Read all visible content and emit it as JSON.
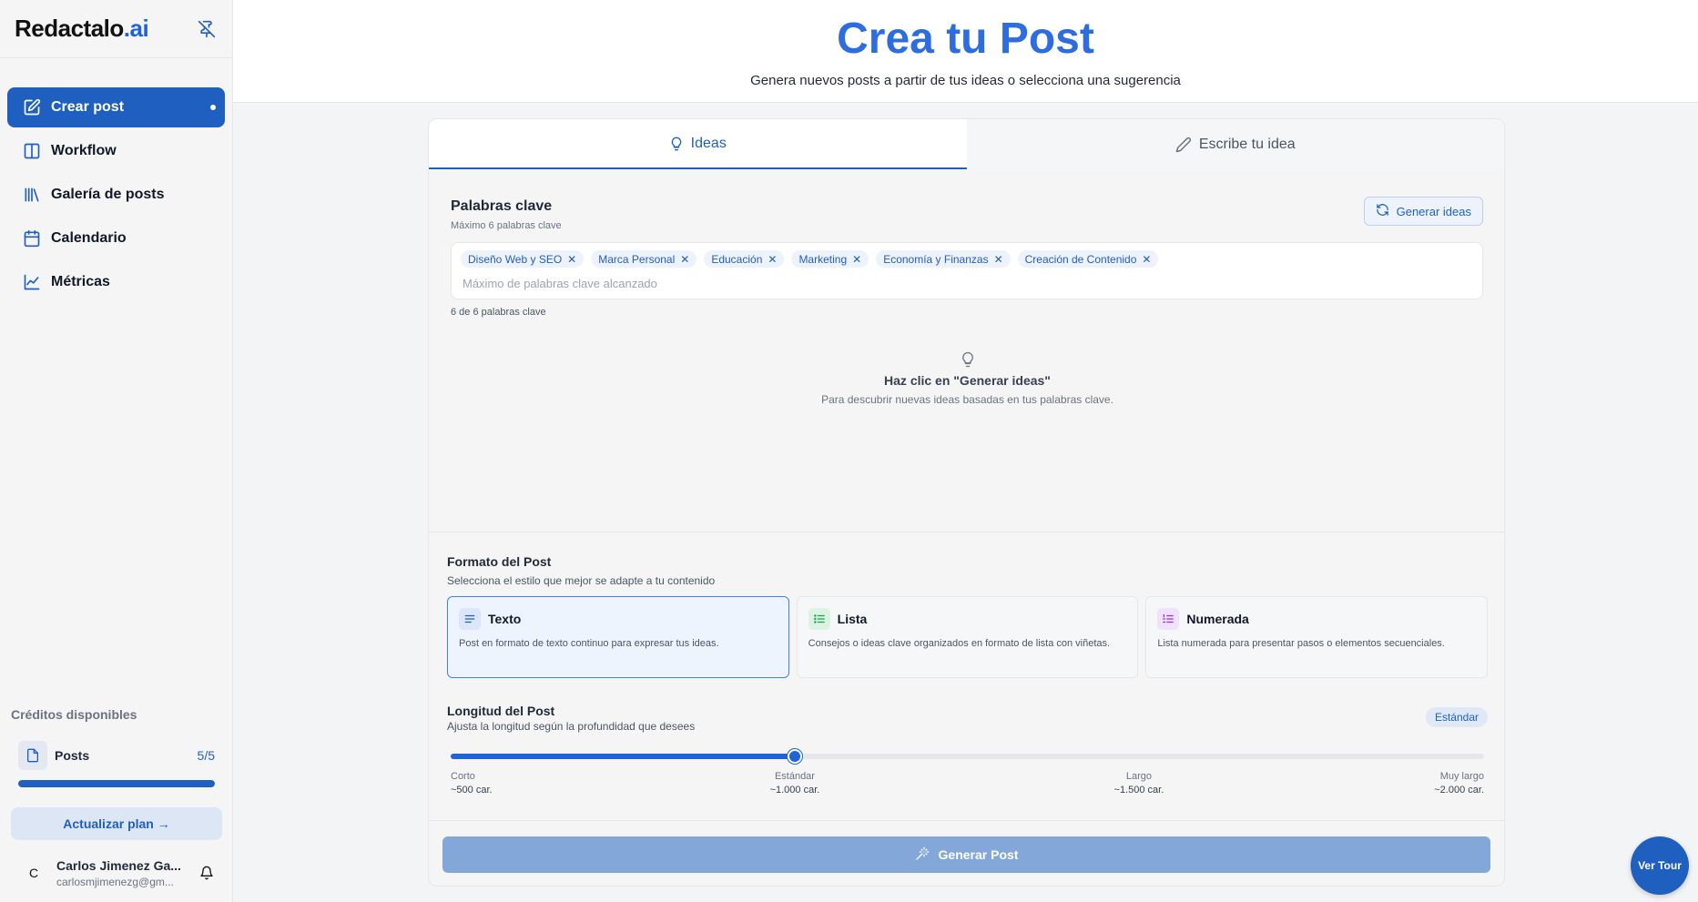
{
  "app": {
    "logo_main": "Redactalo",
    "logo_suffix": ".ai"
  },
  "sidebar": {
    "items": [
      {
        "label": "Crear post",
        "icon": "edit-icon",
        "active": true
      },
      {
        "label": "Workflow",
        "icon": "columns-icon"
      },
      {
        "label": "Galería de posts",
        "icon": "library-icon"
      },
      {
        "label": "Calendario",
        "icon": "calendar-icon"
      },
      {
        "label": "Métricas",
        "icon": "chart-line-icon"
      }
    ],
    "credits_title": "Créditos disponibles",
    "credit": {
      "label": "Posts",
      "count": "5/5",
      "fraction": 1.0
    },
    "upgrade_label": "Actualizar plan →",
    "user": {
      "initial": "C",
      "name": "Carlos Jimenez Ga...",
      "email": "carlosmjimenezg@gm..."
    }
  },
  "header": {
    "title": "Crea tu Post",
    "subtitle": "Genera nuevos posts a partir de tus ideas o selecciona una sugerencia"
  },
  "tabs": [
    {
      "label": "Ideas",
      "icon": "lightbulb-icon",
      "active": true
    },
    {
      "label": "Escribe tu idea",
      "icon": "pencil-icon",
      "active": false
    }
  ],
  "keywords": {
    "title": "Palabras clave",
    "hint": "Máximo 6 palabras clave",
    "generate_label": "Generar ideas",
    "chips": [
      "Diseño Web y SEO",
      "Marca Personal",
      "Educación",
      "Marketing",
      "Economía y Finanzas",
      "Creación de Contenido"
    ],
    "placeholder": "Máximo de palabras clave alcanzado",
    "counter": "6 de 6 palabras clave"
  },
  "empty_state": {
    "title": "Haz clic en \"Generar ideas\"",
    "description": "Para descubrir nuevas ideas basadas en tus palabras clave."
  },
  "format": {
    "title": "Formato del Post",
    "description": "Selecciona el estilo que mejor se adapte a tu contenido",
    "options": [
      {
        "name": "Texto",
        "desc": "Post en formato de texto continuo para expresar tus ideas.",
        "selected": true,
        "color": "#1f5fbf",
        "bg": "#dbe6f8"
      },
      {
        "name": "Lista",
        "desc": "Consejos o ideas clave organizados en formato de lista con viñetas.",
        "selected": false,
        "color": "#16a34a",
        "bg": "#dcf3e4"
      },
      {
        "name": "Numerada",
        "desc": "Lista numerada para presentar pasos o elementos secuenciales.",
        "selected": false,
        "color": "#9333ea",
        "bg": "#efe3fb"
      }
    ]
  },
  "length": {
    "title": "Longitud del Post",
    "description": "Ajusta la longitud según la profundidad que desees",
    "badge": "Estándar",
    "value_fraction": 0.333,
    "stops": [
      {
        "name": "Corto",
        "chars": "~500 car."
      },
      {
        "name": "Estándar",
        "chars": "~1.000 car."
      },
      {
        "name": "Largo",
        "chars": "~1.500 car."
      },
      {
        "name": "Muy largo",
        "chars": "~2.000 car."
      }
    ]
  },
  "generate_post_label": "Generar Post",
  "tour_label": "Ver Tour"
}
